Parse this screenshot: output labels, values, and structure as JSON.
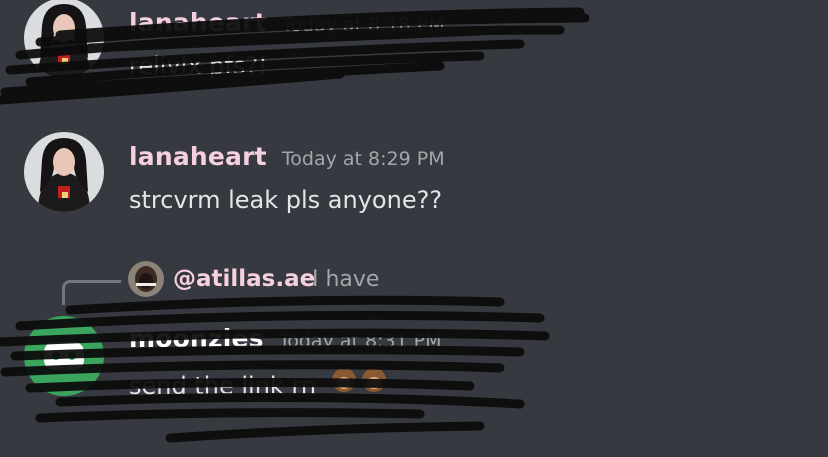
{
  "messages": [
    {
      "author": "lanaheart",
      "timestamp": "Today at 8:18 PM",
      "text": "relivlx pfs?!"
    },
    {
      "author": "lanaheart",
      "timestamp": "Today at 8:29 PM",
      "text": "strcvrm leak pls anyone??"
    },
    {
      "reply_to": {
        "mention": "@atillas.ae",
        "text": "I have"
      },
      "author": "moonzies",
      "timestamp": "Today at 8:31 PM",
      "text": "send the link rn"
    }
  ],
  "icons": {
    "avatar_lanaheart": "user-avatar-photo",
    "avatar_atillas": "user-avatar-photo",
    "avatar_moonzies": "discord-default-avatar",
    "emoji": "monkey-emoji"
  },
  "colors": {
    "background": "#36393f",
    "author_name": "#f6cfe0",
    "timestamp": "#a3a6aa",
    "message_text": "#e3e5e8",
    "default_avatar_green": "#3ba55d"
  }
}
